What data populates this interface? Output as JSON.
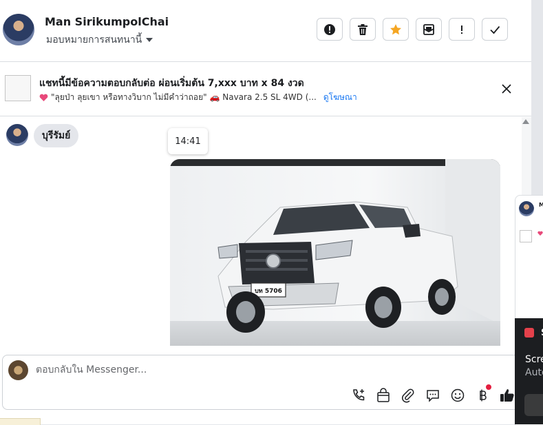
{
  "header": {
    "contact_name": "Man SirikumpolChai",
    "assign_label": "มอบหมายการสนทนานี้",
    "toolbar": [
      {
        "name": "report-button",
        "icon": "exclamation-circle-icon"
      },
      {
        "name": "delete-button",
        "icon": "trash-icon"
      },
      {
        "name": "star-button",
        "icon": "star-icon",
        "color": "#f5a623"
      },
      {
        "name": "mark-unread-button",
        "icon": "envelope-icon"
      },
      {
        "name": "important-button",
        "icon": "exclamation-icon"
      },
      {
        "name": "mark-done-button",
        "icon": "check-icon"
      }
    ]
  },
  "ad": {
    "title": "แชทนี้มีข้อความตอบกลับต่อ ผ่อนเริ่มต้น 7,xxx บาท x 84 งวด",
    "subtitle": "\"ลุยป่า ลุยเขา หรือทางวิบาก ไม่มีคำว่าถอย\" 🚗 Navara 2.5 SL 4WD (...",
    "link": "ดูโฆษณา"
  },
  "messages": {
    "incoming_text": "บุรีรัมย์",
    "timestamp": "14:41",
    "photo_plate": "บท 5706",
    "photo_subject": "white pickup truck photo"
  },
  "composer": {
    "placeholder": "ตอบกลับใน Messenger...",
    "icons": [
      "phone-add-icon",
      "shopping-bag-icon",
      "paperclip-icon",
      "chat-bubble-icon",
      "emoji-icon",
      "baht-payment-icon",
      "thumbs-up-icon"
    ]
  },
  "side_panel": {
    "name_initial": "M",
    "dark_letter": "S",
    "dark_line1": "Scre",
    "dark_line2": "Auto"
  },
  "colors": {
    "accent": "#1877f2",
    "star": "#f5a623",
    "notification": "#e41e3f"
  }
}
